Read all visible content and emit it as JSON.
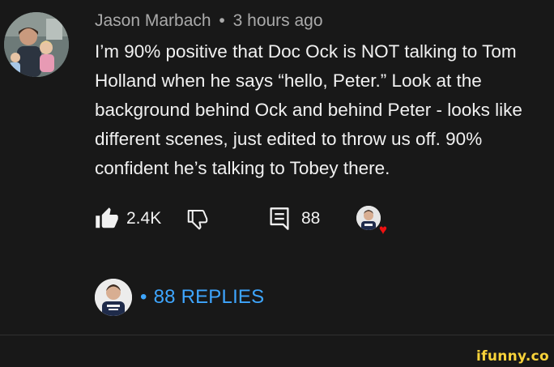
{
  "comment": {
    "author": "Jason Marbach",
    "separator": "•",
    "time": "3 hours ago",
    "text_lines": [
      "I’m 90% positive that Doc Ock is NOT talking to Tom",
      "Holland when he says “hello, Peter.”  Look at the",
      "background behind Ock and behind Peter - looks like",
      "different scenes, just edited to throw us off.  90%",
      "confident he’s talking to Tobey there."
    ],
    "avatar_icon": "user-avatar-photo"
  },
  "actions": {
    "like_icon": "thumbs-up-filled-icon",
    "like_count": "2.4K",
    "dislike_icon": "thumbs-down-outline-icon",
    "reply_icon": "comment-icon",
    "reply_count": "88",
    "creator_heart_icon": "creator-heart-icon"
  },
  "replies": {
    "label": "88 REPLIES",
    "separator": "•",
    "accent_color": "#3ea6ff"
  },
  "watermark": {
    "text": "ifunny.co",
    "color": "#f7d23a"
  },
  "colors": {
    "background": "#181818",
    "primary_text": "#f1f1f1",
    "secondary_text": "#aaaaaa",
    "heart": "#ee1111"
  }
}
